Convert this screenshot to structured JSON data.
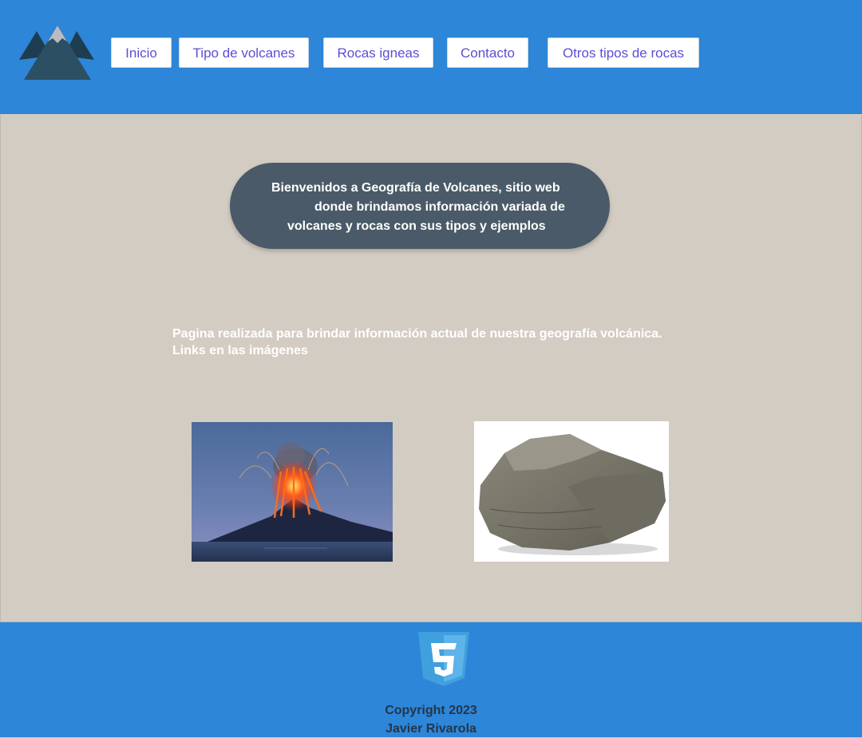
{
  "header": {
    "logo_icon": "mountain-logo-icon",
    "nav": [
      {
        "label": "Inicio"
      },
      {
        "label": "Tipo de volcanes"
      },
      {
        "label": "Rocas igneas"
      },
      {
        "label": "Contacto"
      },
      {
        "label": "Otros tipos de rocas"
      }
    ]
  },
  "main": {
    "welcome_lines": [
      "Bienvenidos a Geografía de Volcanes, sitio web",
      "donde brindamos información variada de",
      "volcanes y rocas con sus tipos y ejemplos"
    ],
    "intro_lines": [
      "Pagina realizada para brindar información actual de nuestra geografía volcánica.",
      "Links en las imágenes"
    ],
    "images": [
      {
        "icon": "volcano-image"
      },
      {
        "icon": "rock-image"
      }
    ]
  },
  "footer": {
    "badge_icon": "css3-icon",
    "copyright_line1": "Copyright 2023",
    "copyright_line2": "Javier Rivarola"
  },
  "colors": {
    "header_bg": "#2d86d8",
    "page_bg": "#d3ccc2",
    "nav_text": "#5a4fd4",
    "welcome_bg": "#4a5a68",
    "footer_text": "#23364a"
  }
}
